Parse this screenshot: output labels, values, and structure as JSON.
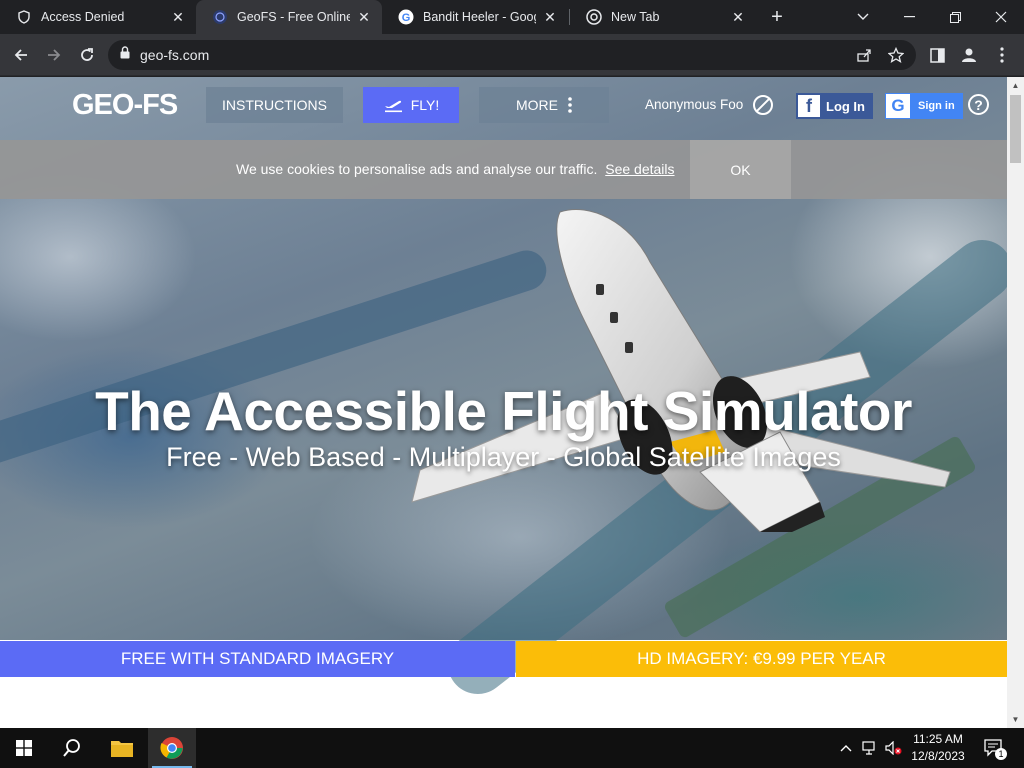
{
  "browser": {
    "tabs": [
      {
        "title": "Access Denied",
        "active": false
      },
      {
        "title": "GeoFS - Free Online Flight Simulator",
        "active": true
      },
      {
        "title": "Bandit Heeler - Google Search",
        "active": false
      },
      {
        "title": "New Tab",
        "active": false
      }
    ],
    "url": "geo-fs.com"
  },
  "nav": {
    "logo": "GEO-FS",
    "instructions": "INSTRUCTIONS",
    "fly": "FLY!",
    "more": "MORE",
    "user": "Anonymous Foo",
    "facebook_login": "Log In",
    "google_signin": "Sign in"
  },
  "cookie": {
    "message": "We use cookies to personalise ads and analyse our traffic.",
    "link": "See details",
    "ok": "OK"
  },
  "hero": {
    "headline": "The Accessible Flight Simulator",
    "subheadline": "Free - Web Based - Multiplayer - Global Satellite Images"
  },
  "cta": {
    "free": "FREE WITH STANDARD IMAGERY",
    "hd": "HD IMAGERY: €9.99 PER YEAR"
  },
  "colors": {
    "accent_blue": "#5b6bf5",
    "accent_yellow": "#fbbd08",
    "facebook": "#3b5998",
    "google": "#4285f4"
  },
  "taskbar": {
    "time": "11:25 AM",
    "date": "12/8/2023",
    "notification_count": "1"
  }
}
